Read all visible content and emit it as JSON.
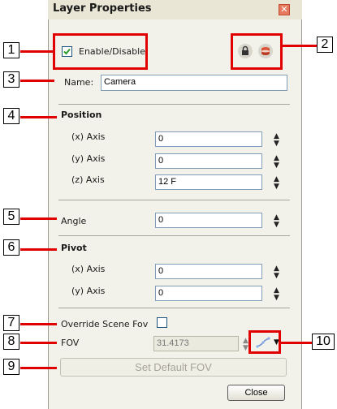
{
  "dialog": {
    "title": "Layer Properties"
  },
  "enable": {
    "label": "Enable/Disable",
    "checked": true
  },
  "name": {
    "label": "Name:",
    "value": "Camera"
  },
  "position": {
    "heading": "Position",
    "x_label": "(x) Axis",
    "x_value": "0",
    "y_label": "(y) Axis",
    "y_value": "0",
    "z_label": "(z) Axis",
    "z_value": "12 F"
  },
  "angle": {
    "label": "Angle",
    "value": "0"
  },
  "pivot": {
    "heading": "Pivot",
    "x_label": "(x) Axis",
    "x_value": "0",
    "y_label": "(y) Axis",
    "y_value": "0"
  },
  "override": {
    "label": "Override Scene Fov",
    "checked": false
  },
  "fov": {
    "label": "FOV",
    "value": "31.4173"
  },
  "buttons": {
    "set_default": "Set Default FOV",
    "close": "Close"
  },
  "callouts": [
    "1",
    "2",
    "3",
    "4",
    "5",
    "6",
    "7",
    "8",
    "9",
    "10"
  ],
  "colors": {
    "callout_red": "#e00000",
    "panel_bg": "#f3f2ea"
  },
  "icons": {
    "lock": "lock-icon",
    "layer": "layer-color-icon",
    "spinner": "spinner-arrows-icon",
    "function": "function-curve-icon"
  }
}
